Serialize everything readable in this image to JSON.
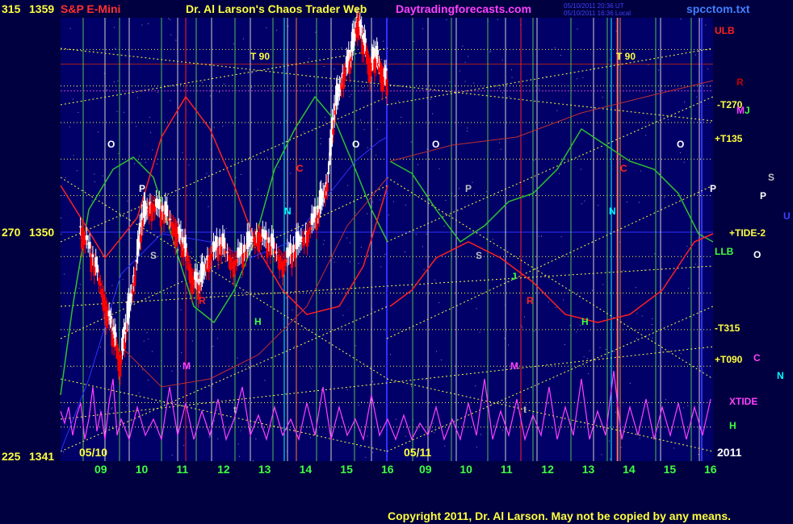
{
  "header": {
    "instrument": "S&P E-Mini",
    "title": "Dr. Al Larson's Chaos Trader Web",
    "site": "Daytradingforecasts.com",
    "file": "spcctom.txt",
    "time_line1": "05/10/2011 20:36 UT",
    "time_line2": "05/10/2011 16:36 Local"
  },
  "footer": {
    "copyright": "Copyright 2011, Dr. Al Larson. May not be copied by any means.",
    "year": "2011"
  },
  "chart_data": {
    "type": "candlestick",
    "y_axis": [
      {
        "degree": "315",
        "price": "1359"
      },
      {
        "degree": "270",
        "price": "1350"
      },
      {
        "degree": "225",
        "price": "1341"
      }
    ],
    "ylim": [
      1341,
      1359
    ],
    "x_days": [
      "05/10",
      "05/11"
    ],
    "x_hours": [
      "09",
      "10",
      "11",
      "12",
      "13",
      "14",
      "15",
      "16",
      "09",
      "10",
      "11",
      "12",
      "13",
      "14",
      "15",
      "16"
    ],
    "price_path_0510": [
      [
        8.5,
        1350.2
      ],
      [
        8.8,
        1348.8
      ],
      [
        9.1,
        1347.0
      ],
      [
        9.3,
        1345.8
      ],
      [
        9.45,
        1344.6
      ],
      [
        9.6,
        1346.0
      ],
      [
        9.8,
        1348.2
      ],
      [
        10.0,
        1350.5
      ],
      [
        10.2,
        1351.2
      ],
      [
        10.5,
        1350.8
      ],
      [
        10.8,
        1350.2
      ],
      [
        11.0,
        1349.5
      ],
      [
        11.2,
        1348.2
      ],
      [
        11.4,
        1347.8
      ],
      [
        11.6,
        1349.0
      ],
      [
        11.9,
        1349.5
      ],
      [
        12.2,
        1348.8
      ],
      [
        12.5,
        1349.2
      ],
      [
        12.8,
        1350.0
      ],
      [
        13.1,
        1349.5
      ],
      [
        13.4,
        1348.8
      ],
      [
        13.7,
        1349.2
      ],
      [
        14.0,
        1350.0
      ],
      [
        14.3,
        1350.8
      ],
      [
        14.5,
        1352.0
      ],
      [
        14.7,
        1355.0
      ],
      [
        14.9,
        1356.5
      ],
      [
        15.1,
        1357.2
      ],
      [
        15.25,
        1358.8
      ],
      [
        15.4,
        1357.8
      ],
      [
        15.55,
        1356.8
      ],
      [
        15.7,
        1357.2
      ],
      [
        15.85,
        1356.5
      ],
      [
        16.0,
        1356.2
      ]
    ],
    "right_labels": [
      {
        "text": "ULB",
        "color": "#ff2020"
      },
      {
        "text": "R",
        "color": "#c00000"
      },
      {
        "text": "-T270",
        "color": "#ffff40"
      },
      {
        "text": "M",
        "color": "#ff40ff"
      },
      {
        "text": "J",
        "color": "#40ff40"
      },
      {
        "text": "+T135",
        "color": "#ffff40"
      },
      {
        "text": "S",
        "color": "#c0c0c0"
      },
      {
        "text": "P",
        "color": "#ffffff"
      },
      {
        "text": "U",
        "color": "#4040ff"
      },
      {
        "text": "+TIDE-2",
        "color": "#ffff40"
      },
      {
        "text": "LLB",
        "color": "#40ff40"
      },
      {
        "text": "O",
        "color": "#ffffff"
      },
      {
        "text": "-T315",
        "color": "#ffff40"
      },
      {
        "text": "+T090",
        "color": "#ffff40"
      },
      {
        "text": "C",
        "color": "#ff40ff"
      },
      {
        "text": "N",
        "color": "#00ffff"
      },
      {
        "text": "XTIDE",
        "color": "#ff40ff"
      },
      {
        "text": "H",
        "color": "#40ff40"
      }
    ],
    "plot_labels": [
      {
        "text": "T  90",
        "color": "#ffff40"
      },
      {
        "text": "T  90",
        "color": "#ffff40"
      },
      {
        "text": "O",
        "color": "#ffffff"
      },
      {
        "text": "O",
        "color": "#ffffff"
      },
      {
        "text": "O",
        "color": "#ffffff"
      },
      {
        "text": "O",
        "color": "#ffffff"
      },
      {
        "text": "P",
        "color": "#ffffff"
      },
      {
        "text": "P",
        "color": "#c0c0c0"
      },
      {
        "text": "P",
        "color": "#ffffff"
      },
      {
        "text": "S",
        "color": "#c0c0c0"
      },
      {
        "text": "S",
        "color": "#c0c0c0"
      },
      {
        "text": "C",
        "color": "#ff2020"
      },
      {
        "text": "C",
        "color": "#ff2020"
      },
      {
        "text": "N",
        "color": "#00ffff"
      },
      {
        "text": "N",
        "color": "#00ffff"
      },
      {
        "text": "R",
        "color": "#ff2020"
      },
      {
        "text": "R",
        "color": "#ff2020"
      },
      {
        "text": "H",
        "color": "#40ff40"
      },
      {
        "text": "H",
        "color": "#40ff40"
      },
      {
        "text": "J",
        "color": "#40ff40"
      },
      {
        "text": "M",
        "color": "#ff40ff"
      },
      {
        "text": "M",
        "color": "#ff40ff"
      },
      {
        "text": "t",
        "color": "#c0c0c0"
      },
      {
        "text": "t",
        "color": "#c0c0c0"
      }
    ],
    "colors": {
      "background": "#000040",
      "plot_background": "#000070",
      "price_up": "#ffffff",
      "price_down": "#ff0000",
      "yellow_lines": "#ffff40",
      "green_lines": "#40c040",
      "red_lines": "#ff2020",
      "magenta": "#ff40ff",
      "cyan": "#00ffff",
      "blue": "#3030ff"
    }
  }
}
